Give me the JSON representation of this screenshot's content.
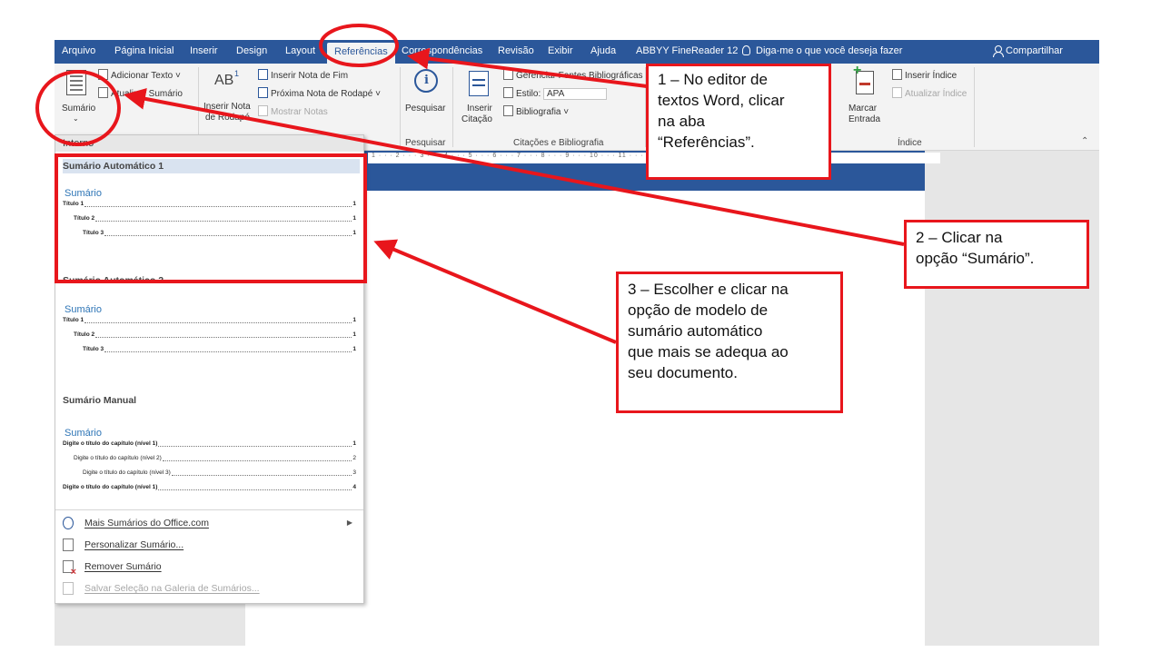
{
  "tabs": [
    "Arquivo",
    "Página Inicial",
    "Inserir",
    "Design",
    "Layout",
    "Referências",
    "Correspondências",
    "Revisão",
    "Exibir",
    "Ajuda",
    "ABBYY FineReader 12"
  ],
  "tell_me": "Diga-me o que você deseja fazer",
  "share": "Compartilhar",
  "ribbon": {
    "sumario": "Sumário",
    "adicionar_texto": "Adicionar Texto",
    "atualizar_sumario": "Atualizar Sumário",
    "inserir_nota_rodape_1": "Inserir Nota",
    "inserir_nota_rodape_2": "de Rodapé",
    "ab_glyph": "AB",
    "inserir_nota_fim": "Inserir Nota de Fim",
    "proxima_nota": "Próxima Nota de Rodapé",
    "mostrar_notas": "Mostrar Notas",
    "pesquisar": "Pesquisar",
    "inserir_citacao_1": "Inserir",
    "inserir_citacao_2": "Citação",
    "gerenciar_fontes": "Gerenciar Fontes Bibliográficas",
    "estilo_label": "Estilo:",
    "estilo_value": "APA",
    "bibliografia": "Bibliografia",
    "marcar_entrada_1": "Marcar",
    "marcar_entrada_2": "Entrada",
    "inserir_indice": "Inserir Índice",
    "atualizar_indice": "Atualizar Índice",
    "group_pesquisar": "Pesquisar",
    "group_citacoes": "Citações e Bibliografia",
    "group_indice": "Índice"
  },
  "ruler_text": "1 · · · 2 · · · 3 · · · 4 · · · 5 · · · 6 · · · 7 · · · 8 · · · 9 · · · 10 · · · 11 · · · 12 · · · 13 · · · 14 · · · 15 · · · 16 · · · 17 · · ·",
  "dropdown": {
    "header": "Interno",
    "gallery": [
      {
        "title": "Sumário Automático 1",
        "heading": "Sumário",
        "lines": [
          {
            "text": "Título 1",
            "page": "1"
          },
          {
            "text": "Título 2",
            "page": "1"
          },
          {
            "text": "Título 3",
            "page": "1"
          }
        ]
      },
      {
        "title": "Sumário Automático 2",
        "heading": "Sumário",
        "lines": [
          {
            "text": "Título 1",
            "page": "1"
          },
          {
            "text": "Título 2",
            "page": "1"
          },
          {
            "text": "Título 3",
            "page": "1"
          }
        ]
      },
      {
        "title": "Sumário Manual",
        "heading": "Sumário",
        "lines": [
          {
            "text": "Digite o título do capítulo (nível 1)",
            "page": "1"
          },
          {
            "text": "Digite o título do capítulo (nível 2)",
            "page": "2"
          },
          {
            "text": "Digite o título do capítulo (nível 3)",
            "page": "3"
          },
          {
            "text": "Digite o título do capítulo (nível 1)",
            "page": "4"
          }
        ]
      }
    ],
    "menu": [
      {
        "label": "Mais Sumários do Office.com",
        "icon": "office-icon",
        "enabled": true,
        "submenu": true
      },
      {
        "label": "Personalizar Sumário...",
        "icon": "customize-icon",
        "enabled": true
      },
      {
        "label": "Remover Sumário",
        "icon": "remove-icon",
        "enabled": true
      },
      {
        "label": "Salvar Seleção na Galeria de Sumários...",
        "icon": "save-gallery-icon",
        "enabled": false
      }
    ]
  },
  "callouts": {
    "c1": [
      "1 – No editor de",
      "textos Word, clicar",
      "na aba",
      "“Referências”."
    ],
    "c2": [
      "2 – Clicar na",
      "opção “Sumário”."
    ],
    "c3": [
      "3 – Escolher e clicar na",
      "opção de modelo de",
      "sumário automático",
      "que mais se adequa ao",
      "seu documento."
    ]
  },
  "colors": {
    "word_blue": "#2b579a",
    "annotation_red": "#e8161c"
  }
}
